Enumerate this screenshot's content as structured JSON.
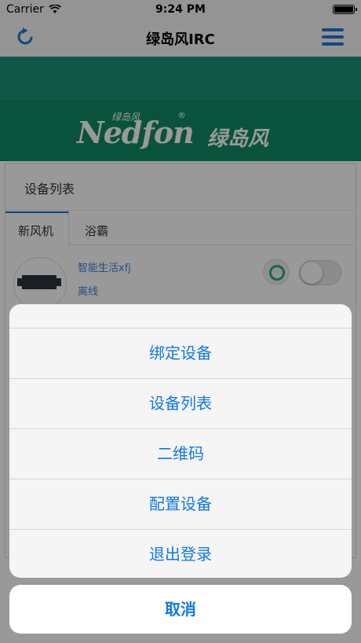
{
  "status_bar": {
    "carrier": "Carrier",
    "time": "9:24 PM"
  },
  "nav": {
    "title": "绿岛风IRC",
    "left_icon": "refresh-icon",
    "right_icon": "menu-icon"
  },
  "brand": {
    "logo_small": "绿岛风",
    "logo_reg": "®",
    "logo_name": "Nedfon",
    "logo_cn": "绿岛风"
  },
  "panel": {
    "heading": "设备列表",
    "tabs": [
      {
        "label": "新风机",
        "active": true
      },
      {
        "label": "浴霸",
        "active": false
      }
    ],
    "device": {
      "name": "智能生活xfj",
      "status": "离线",
      "toggle_on": false
    }
  },
  "action_sheet": {
    "items": [
      "绑定设备",
      "设备列表",
      "二维码",
      "配置设备",
      "退出登录"
    ],
    "cancel": "取消"
  },
  "colors": {
    "accent": "#1477e6",
    "teal": "#0f8b66",
    "status_green": "#2aa884"
  }
}
